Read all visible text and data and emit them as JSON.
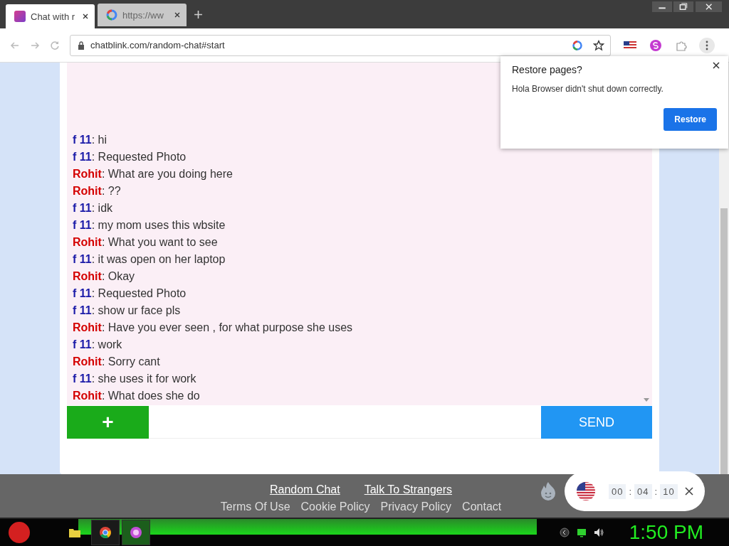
{
  "tabs": [
    {
      "label": "Chat with r",
      "selected": true
    },
    {
      "label": "https://ww",
      "selected": false
    }
  ],
  "address_bar": {
    "url": "chatblink.com/random-chat#start"
  },
  "messages": [
    {
      "sender": "f 11",
      "kind": "stranger",
      "text": ": hi"
    },
    {
      "sender": "f 11",
      "kind": "stranger",
      "text": ": Requested Photo"
    },
    {
      "sender": "Rohit",
      "kind": "me",
      "text": ": What are you doing here"
    },
    {
      "sender": "Rohit",
      "kind": "me",
      "text": ": ??"
    },
    {
      "sender": "f 11",
      "kind": "stranger",
      "text": ": idk"
    },
    {
      "sender": "f 11",
      "kind": "stranger",
      "text": ": my mom uses this wbsite"
    },
    {
      "sender": "Rohit",
      "kind": "me",
      "text": ": What you want to see"
    },
    {
      "sender": "f 11",
      "kind": "stranger",
      "text": ": it was open on her laptop"
    },
    {
      "sender": "Rohit",
      "kind": "me",
      "text": ": Okay"
    },
    {
      "sender": "f 11",
      "kind": "stranger",
      "text": ": Requested Photo"
    },
    {
      "sender": "f 11",
      "kind": "stranger",
      "text": ": show ur face pls"
    },
    {
      "sender": "Rohit",
      "kind": "me",
      "text": ": Have you ever seen , for what purpose she uses"
    },
    {
      "sender": "f 11",
      "kind": "stranger",
      "text": ": work"
    },
    {
      "sender": "Rohit",
      "kind": "me",
      "text": ": Sorry cant"
    },
    {
      "sender": "f 11",
      "kind": "stranger",
      "text": ": she uses it for work"
    },
    {
      "sender": "Rohit",
      "kind": "me",
      "text": ": What does she do"
    }
  ],
  "composer": {
    "add_label": "+",
    "send_label": "SEND"
  },
  "footer": {
    "links": [
      "Random Chat",
      "Talk To Strangers"
    ],
    "links_2": [
      "Terms Of Use",
      "Cookie Policy",
      "Privacy Policy",
      "Contact"
    ]
  },
  "restore_dialog": {
    "title": "Restore pages?",
    "message": "Hola Browser didn't shut down correctly.",
    "button": "Restore"
  },
  "timer": {
    "hours": "00",
    "minutes": "04",
    "seconds": "10",
    "separators": [
      ":",
      ":"
    ]
  },
  "taskbar": {
    "clock": "1:50 PM"
  }
}
